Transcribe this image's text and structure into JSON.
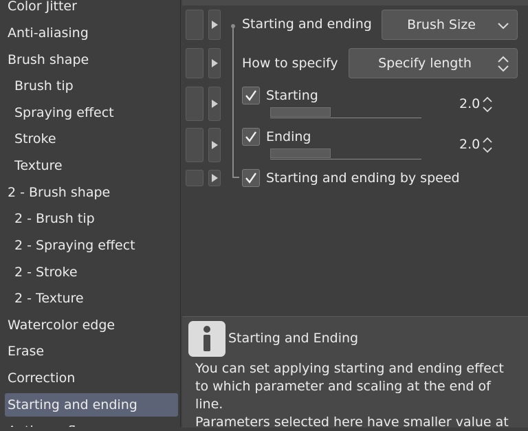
{
  "sidebar": {
    "items": [
      {
        "label": "Color Jitter",
        "level": 0
      },
      {
        "label": "Anti-aliasing",
        "level": 0
      },
      {
        "label": "Brush shape",
        "level": 0
      },
      {
        "label": "Brush tip",
        "level": 1
      },
      {
        "label": "Spraying effect",
        "level": 1
      },
      {
        "label": "Stroke",
        "level": 1
      },
      {
        "label": "Texture",
        "level": 1
      },
      {
        "label": "2 - Brush shape",
        "level": 0
      },
      {
        "label": "2 - Brush tip",
        "level": 1
      },
      {
        "label": "2 - Spraying effect",
        "level": 1
      },
      {
        "label": "2 - Stroke",
        "level": 1
      },
      {
        "label": "2 - Texture",
        "level": 1
      },
      {
        "label": "Watercolor edge",
        "level": 0
      },
      {
        "label": "Erase",
        "level": 0
      },
      {
        "label": "Correction",
        "level": 0
      },
      {
        "label": "Starting and ending",
        "level": 0,
        "selected": true
      },
      {
        "label": "Anti-overflow",
        "level": 0
      }
    ]
  },
  "settings": {
    "starting_ending_label": "Starting and ending",
    "starting_ending_value": "Brush Size",
    "how_to_specify_label": "How to specify",
    "how_to_specify_value": "Specify length",
    "starting": {
      "label": "Starting",
      "checked": true,
      "value": "2.0",
      "slider_fraction": 0.4
    },
    "ending": {
      "label": "Ending",
      "checked": true,
      "value": "2.0",
      "slider_fraction": 0.4
    },
    "by_speed": {
      "label": "Starting and ending by speed",
      "checked": true
    }
  },
  "info": {
    "title": "Starting and Ending",
    "icon": "info-icon",
    "paragraph1": "You can set applying starting and ending effect to which parameter and scaling at the end of line.",
    "paragraph2": "Parameters selected here have smaller value at"
  },
  "colors": {
    "background": "#3e3e3e",
    "selected_item": "#5c6377",
    "panel": "#484848"
  }
}
